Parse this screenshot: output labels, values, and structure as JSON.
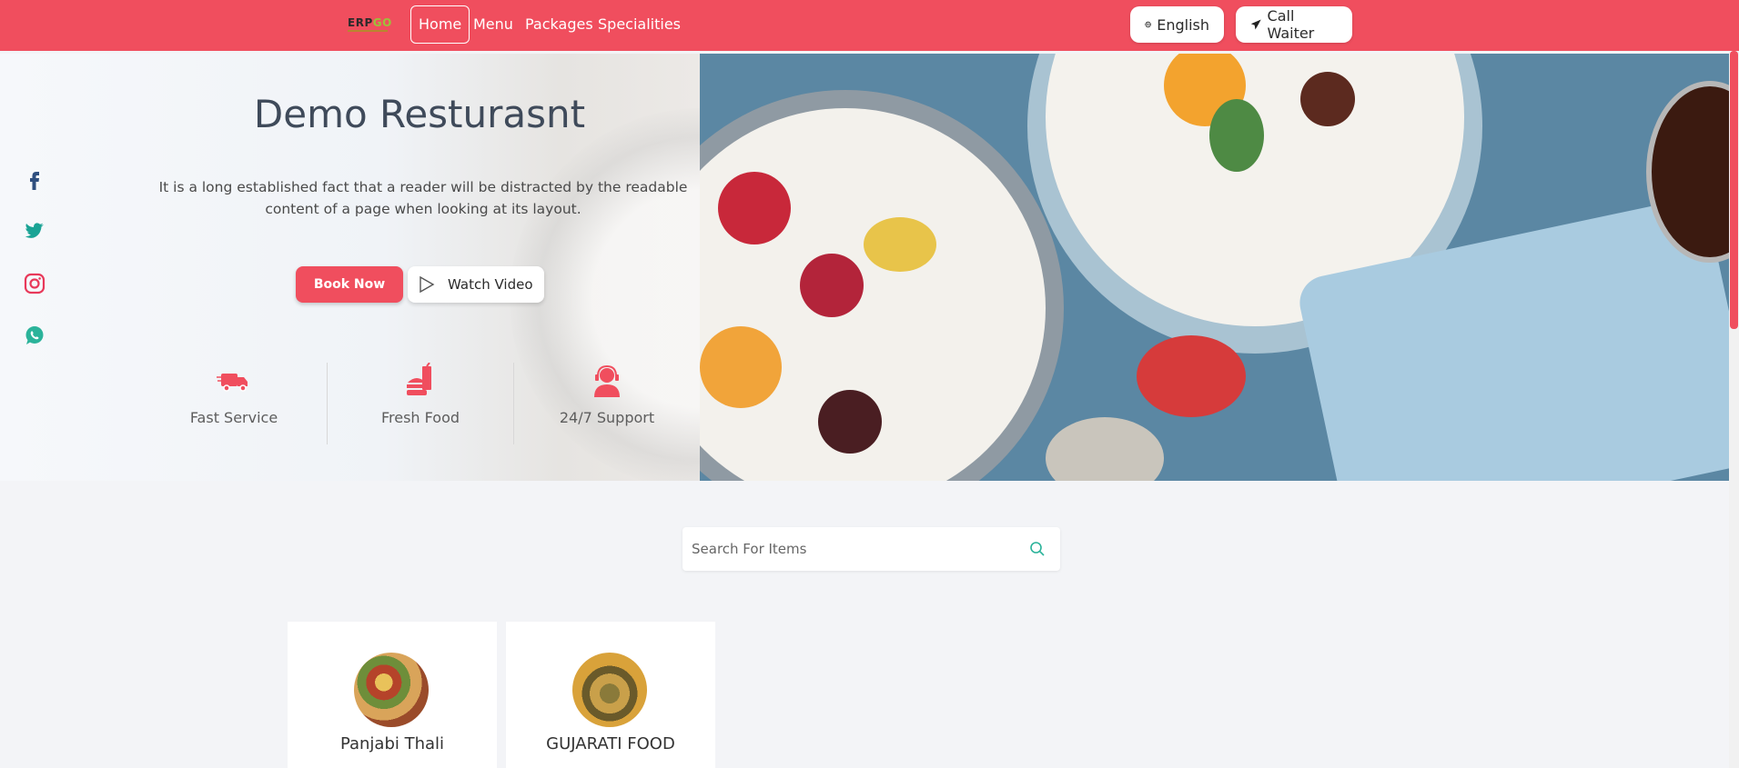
{
  "brand": {
    "logo_main": "ERP",
    "logo_accent": "GO"
  },
  "nav": {
    "items": [
      {
        "label": "Home",
        "active": true
      },
      {
        "label": "Menu",
        "active": false
      },
      {
        "label": "Packages",
        "active": false
      },
      {
        "label": "Specialities",
        "active": false
      }
    ],
    "language_label": "English",
    "call_waiter_label": "Call Waiter"
  },
  "hero": {
    "title": "Demo Resturasnt",
    "description": "It is a long established fact that a reader will be distracted by the readable content of a page when looking at its layout.",
    "book_now_label": "Book Now",
    "watch_video_label": "Watch Video",
    "features": [
      {
        "icon": "truck-icon",
        "label": "Fast Service"
      },
      {
        "icon": "burger-icon",
        "label": "Fresh Food"
      },
      {
        "icon": "headset-icon",
        "label": "24/7 Support"
      }
    ]
  },
  "social": [
    "facebook-icon",
    "twitter-icon",
    "instagram-icon",
    "whatsapp-icon"
  ],
  "search": {
    "placeholder": "Search For Items"
  },
  "categories": [
    {
      "name": "Panjabi Thali"
    },
    {
      "name": "GUJARATI FOOD"
    }
  ],
  "colors": {
    "accent": "#f04e5e",
    "search_icon": "#2bb39a",
    "twitter": "#1aa395",
    "instagram": "#e8395a",
    "whatsapp": "#2bb39a",
    "facebook": "#2f4f7f"
  }
}
